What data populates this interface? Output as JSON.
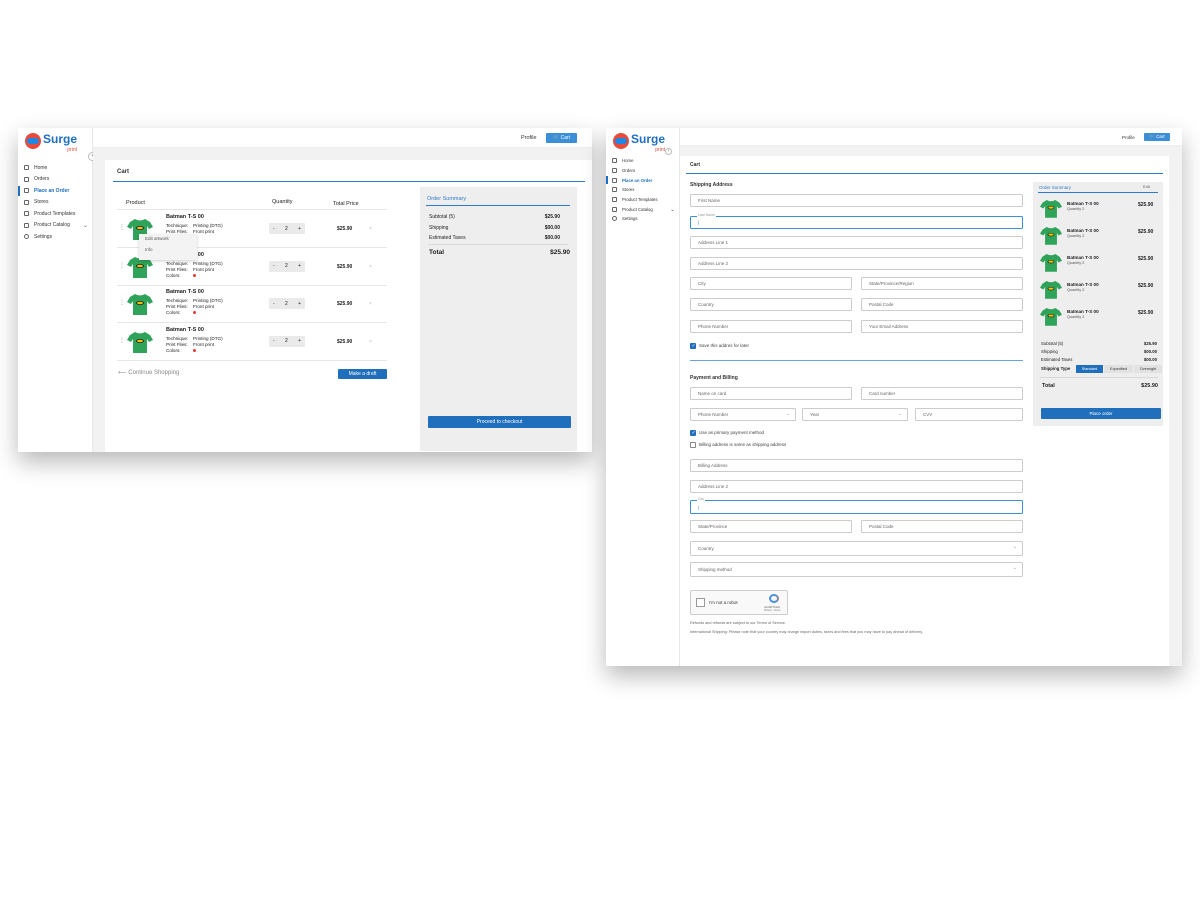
{
  "brand": {
    "name": "Surge",
    "sub": "print"
  },
  "topbar": {
    "profile": "Profile",
    "cart": "Cart"
  },
  "nav": [
    {
      "label": "Home"
    },
    {
      "label": "Orders"
    },
    {
      "label": "Place an Order",
      "active": true
    },
    {
      "label": "Stores"
    },
    {
      "label": "Product Templates"
    },
    {
      "label": "Product Catalog",
      "expandable": true
    },
    {
      "label": "Settings"
    }
  ],
  "cart": {
    "title": "Cart",
    "headers": {
      "product": "Product",
      "quantity": "Quantity",
      "total": "Total Price"
    },
    "labels": {
      "technique": "Technique:",
      "print_files": "Print Files:",
      "colors": "Colors:"
    },
    "items": [
      {
        "name": "Batman T-S 00",
        "technique": "Printing (DTG)",
        "print_files": "Front print",
        "qty": "2",
        "price": "$25.90"
      },
      {
        "name": "Batman T-S 00",
        "technique": "Printing (DTG)",
        "print_files": "Front print",
        "qty": "2",
        "price": "$25.90"
      },
      {
        "name": "Batman T-S 00",
        "technique": "Printing (DTG)",
        "print_files": "Front print",
        "qty": "2",
        "price": "$25.90"
      },
      {
        "name": "Batman T-S 00",
        "technique": "Printing (DTG)",
        "print_files": "Front print",
        "qty": "2",
        "price": "$25.90"
      }
    ],
    "item_menu": {
      "edit": "Edit artwork",
      "info": "Info"
    },
    "continue": "Continue Shopping",
    "draft": "Make a draft",
    "summary": {
      "title": "Order Summary",
      "subtotal_label": "Subtotal (5)",
      "subtotal": "$25.90",
      "shipping_label": "Shipping",
      "shipping": "$00.00",
      "taxes_label": "Estimated Taxes",
      "taxes": "$00.00",
      "total_label": "Total",
      "total": "$25.90",
      "checkout": "Proceed to checkout"
    }
  },
  "checkout": {
    "title": "Cart",
    "shipping_title": "Shipping Address",
    "fields": {
      "first_name": "First Name",
      "last_name_label": "Last Name",
      "last_name_value": "|",
      "address1": "Address Line 1",
      "address2": "Address Line 2",
      "city": "City",
      "state": "State/Province/Region",
      "country": "Country",
      "postal": "Postal Code",
      "phone": "Phone Number",
      "email": "Your Email Address"
    },
    "save_address": "Save this addres for later",
    "payment_title": "Payment and Billing",
    "payment": {
      "name_on_card": "Name on card",
      "card_number": "Card number",
      "phone_number": "Phone Number",
      "year": "Year",
      "cvv": "CVV"
    },
    "primary_payment": "Use as primary payment method",
    "billing_same": "Billing address is same as shipping address",
    "billing": {
      "address": "Billing Address",
      "address2": "Address Line 2",
      "city_label": "City",
      "city_value": "|",
      "state": "State/Province",
      "postal": "Postal Code",
      "country": "Country",
      "shipping_method": "Shipping method"
    },
    "captcha": {
      "label": "I'm not a robot",
      "brand": "reCAPTCHA",
      "links": "Privacy - Terms"
    },
    "note1": "Refunds and refunds are subject to our Terms of Service.",
    "note2": "International Shipping: Please note that your country may charge import duties, taxes and fees that you may have to pay ahead of delivery.",
    "summary": {
      "title": "Order Summary",
      "edit": "Edit",
      "items": [
        {
          "name": "Batman T-S 00",
          "qty": "Quantity 2",
          "price": "$25.90"
        },
        {
          "name": "Batman T-S 00",
          "qty": "Quantity 2",
          "price": "$25.90"
        },
        {
          "name": "Batman T-S 00",
          "qty": "Quantity 2",
          "price": "$25.90"
        },
        {
          "name": "Batman T-S 00",
          "qty": "Quantity 2",
          "price": "$25.90"
        },
        {
          "name": "Batman T-S 00",
          "qty": "Quantity 2",
          "price": "$25.90"
        }
      ],
      "subtotal_label": "Subtotal (5)",
      "subtotal": "$25.90",
      "shipping_label": "Shipping",
      "shipping": "$00.00",
      "taxes_label": "Estimated Taxes",
      "taxes": "$00.00",
      "shipping_type_label": "Shipping Type",
      "shipping_types": [
        "Standard",
        "Expedited",
        "Overnight"
      ],
      "total_label": "Total",
      "total": "$25.90",
      "place_order": "Place order"
    }
  },
  "colors": {
    "accent": "#1f6fbd",
    "shirt": "#2fa35a",
    "brand_red": "#e64b3c"
  }
}
